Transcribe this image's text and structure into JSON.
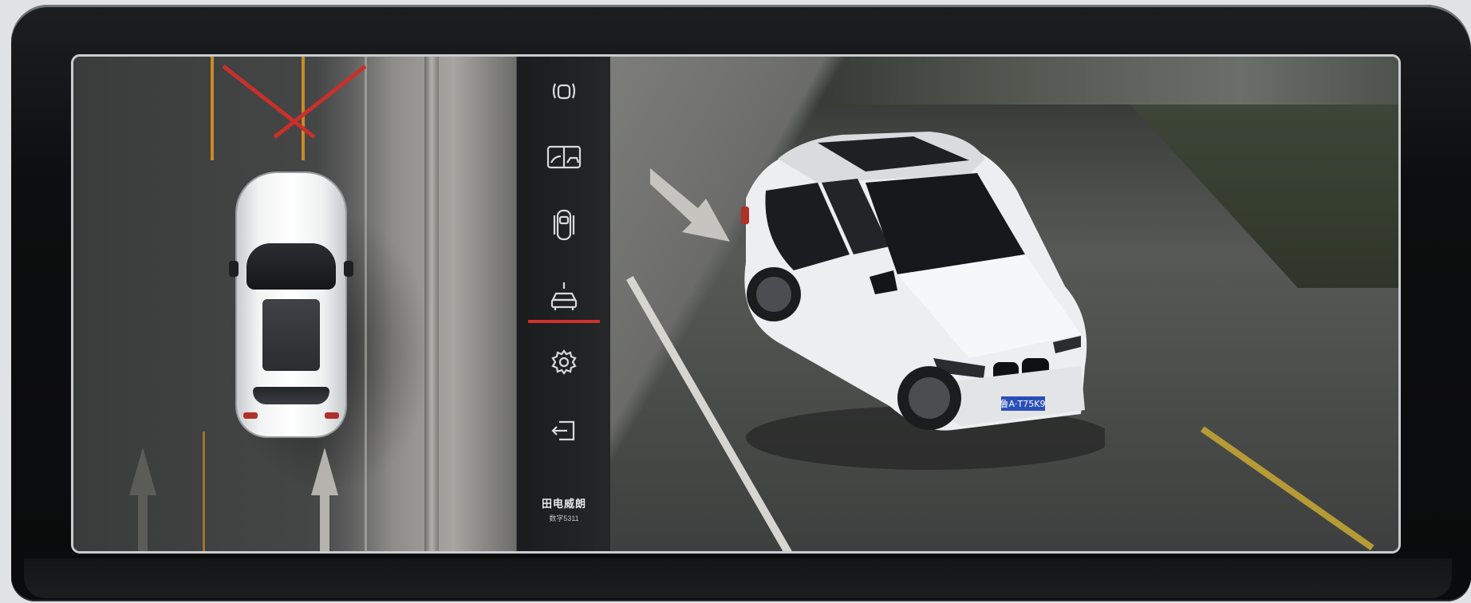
{
  "menu": {
    "items": [
      {
        "name": "front-camera-icon",
        "label": ""
      },
      {
        "name": "split-view-icon",
        "label": ""
      },
      {
        "name": "top-view-car-icon",
        "label": ""
      },
      {
        "name": "car-front-view-icon",
        "label": "",
        "active": true
      },
      {
        "name": "settings-gear-icon",
        "label": ""
      },
      {
        "name": "exit-icon",
        "label": ""
      }
    ],
    "brand_name": "田电威朗",
    "brand_sub": "数字5311"
  },
  "plate": "鲁A·T75K9",
  "colors": {
    "active_indicator": "#d0312b",
    "lane_line": "#c98a26",
    "x_mark": "#c8302a"
  }
}
